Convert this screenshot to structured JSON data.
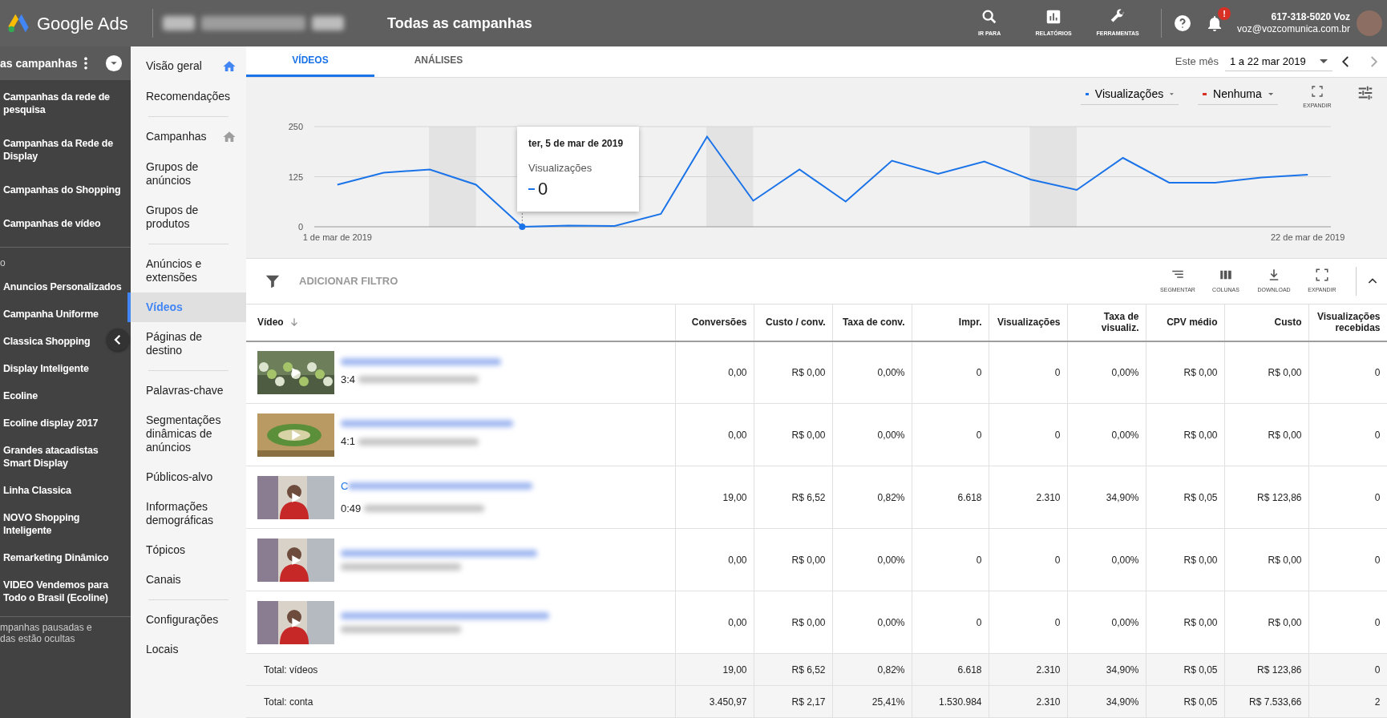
{
  "topbar": {
    "product": "Google Ads",
    "title": "Todas as campanhas",
    "tools": [
      "IR PARA",
      "RELATÓRIOS",
      "FERRAMENTAS"
    ],
    "notification_badge": "!",
    "account_id": "617-318-5020 Voz",
    "email": "voz@vozcomunica.com.br"
  },
  "campaign_panel": {
    "header": "as campanhas",
    "groups": [
      {
        "items": [
          "Campanhas da rede de pesquisa",
          "Campanhas da Rede de Display",
          "Campanhas do Shopping",
          "Campanhas de vídeo"
        ]
      },
      {
        "label": "o",
        "items": [
          "Anuncios Personalizados",
          "Campanha Uniforme",
          "Classica Shopping",
          "Display Inteligente",
          "Ecoline",
          "Ecoline display 2017",
          "Grandes atacadistas Smart Display",
          "Linha Classica",
          "NOVO Shopping Inteligente",
          "Remarketing Dinâmico",
          "VIDEO Vendemos para Todo o Brasil (Ecoline)"
        ]
      }
    ],
    "footer": [
      "mpanhas pausadas e",
      "das estão ocultas"
    ]
  },
  "nav": {
    "groups": [
      [
        {
          "label": "Visão geral",
          "selected": false,
          "home_active": true
        },
        {
          "label": "Recomendações",
          "selected": false
        }
      ],
      [
        {
          "label": "Campanhas",
          "selected": false,
          "home_active": false
        },
        {
          "label": "Grupos de anúncios",
          "selected": false
        },
        {
          "label": "Grupos de produtos",
          "selected": false
        }
      ],
      [
        {
          "label": "Anúncios e extensões",
          "selected": false
        },
        {
          "label": "Vídeos",
          "selected": true
        },
        {
          "label": "Páginas de destino",
          "selected": false
        }
      ],
      [
        {
          "label": "Palavras-chave",
          "selected": false
        },
        {
          "label": "Segmentações dinâmicas de anúncios",
          "selected": false
        },
        {
          "label": "Públicos-alvo",
          "selected": false
        },
        {
          "label": "Informações demográficas",
          "selected": false
        },
        {
          "label": "Tópicos",
          "selected": false
        },
        {
          "label": "Canais",
          "selected": false
        }
      ],
      [
        {
          "label": "Configurações",
          "selected": false
        },
        {
          "label": "Locais",
          "selected": false
        }
      ]
    ]
  },
  "tabs": [
    {
      "label": "VÍDEOS",
      "selected": true
    },
    {
      "label": "ANÁLISES",
      "selected": false
    }
  ],
  "date_range": {
    "label": "Este mês",
    "value": "1 a 22 mar 2019"
  },
  "chart": {
    "metrics": [
      {
        "label": "Visualizações",
        "color": "#1a73e8"
      },
      {
        "label": "Nenhuma",
        "color": "#d93025"
      }
    ],
    "expand_label": "EXPANDIR",
    "tooltip": {
      "date": "ter, 5 de mar de 2019",
      "value": "0"
    },
    "chart_data": {
      "type": "line",
      "categories": [
        "1 de mar de 2019",
        null,
        null,
        null,
        null,
        null,
        null,
        null,
        null,
        null,
        null,
        null,
        null,
        null,
        null,
        null,
        null,
        null,
        null,
        null,
        null,
        "22 de mar de 2019"
      ],
      "series": [
        {
          "name": "Visualizações",
          "color": "#1a73e8",
          "values": [
            105,
            135,
            143,
            105,
            0,
            3,
            2,
            32,
            225,
            65,
            143,
            63,
            165,
            132,
            163,
            118,
            92,
            172,
            110,
            110,
            123,
            130
          ]
        }
      ],
      "ylim": [
        0,
        250
      ],
      "yticks": [
        0,
        125,
        250
      ]
    }
  },
  "filter": {
    "label": "ADICIONAR FILTRO",
    "actions": [
      "SEGMENTAR",
      "COLUNAS",
      "DOWNLOAD",
      "EXPANDIR"
    ]
  },
  "table": {
    "video_column": {
      "label": "Vídeo",
      "sorted": true
    },
    "columns": [
      {
        "label": "Conversões",
        "sorted": false
      },
      {
        "label": "Custo / conv.",
        "sorted": false
      },
      {
        "label": "Taxa de conv.",
        "sorted": false
      },
      {
        "label": "Impr.",
        "sorted": false
      },
      {
        "label": "Visualizações",
        "sorted": false
      },
      {
        "label": "Taxa de visualiz.",
        "sorted": false
      },
      {
        "label": "CPV médio",
        "sorted": false
      },
      {
        "label": "Custo",
        "sorted": false
      },
      {
        "label": "Visualizações recebidas",
        "sorted": false
      }
    ],
    "rows": [
      {
        "duration": "3:4",
        "cells": [
          "0,00",
          "R$ 0,00",
          "0,00%",
          "0",
          "0",
          "0,00%",
          "R$ 0,00",
          "R$ 0,00",
          "0"
        ]
      },
      {
        "duration": "4:1",
        "cells": [
          "0,00",
          "R$ 0,00",
          "0,00%",
          "0",
          "0",
          "0,00%",
          "R$ 0,00",
          "R$ 0,00",
          "0"
        ]
      },
      {
        "title": "C",
        "duration": "0:49",
        "cells": [
          "19,00",
          "R$ 6,52",
          "0,82%",
          "6.618",
          "2.310",
          "34,90%",
          "R$ 0,05",
          "R$ 123,86",
          "0"
        ]
      },
      {
        "cells": [
          "0,00",
          "R$ 0,00",
          "0,00%",
          "0",
          "0",
          "0,00%",
          "R$ 0,00",
          "R$ 0,00",
          "0"
        ]
      },
      {
        "cells": [
          "0,00",
          "R$ 0,00",
          "0,00%",
          "0",
          "0",
          "0,00%",
          "R$ 0,00",
          "R$ 0,00",
          "0"
        ]
      }
    ],
    "totals": [
      {
        "label": "Total: vídeos",
        "cells": [
          "19,00",
          "R$ 6,52",
          "0,82%",
          "6.618",
          "2.310",
          "34,90%",
          "R$ 0,05",
          "R$ 123,86",
          "0"
        ]
      },
      {
        "label": "Total: conta",
        "cells": [
          "3.450,97",
          "R$ 2,17",
          "25,41%",
          "1.530.984",
          "2.310",
          "34,90%",
          "R$ 0,05",
          "R$ 7.533,66",
          "2"
        ]
      }
    ]
  }
}
